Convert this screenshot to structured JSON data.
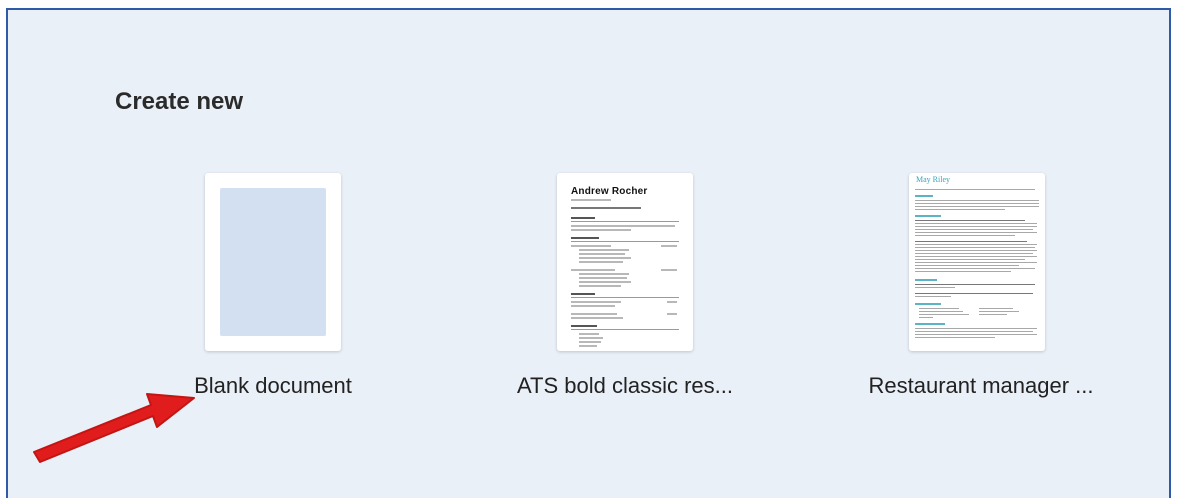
{
  "section": {
    "title": "Create new"
  },
  "templates": [
    {
      "label": "Blank document"
    },
    {
      "label": "ATS bold classic res...",
      "preview_name": "Andrew Rocher"
    },
    {
      "label": "Restaurant manager ...",
      "preview_name": "May Riley"
    }
  ],
  "colors": {
    "background": "#eaf0f8",
    "frame_border": "#2e5aa8",
    "blank_fill": "#d3e0f2",
    "annotation_arrow": "#e01c1c",
    "restaurant_accent": "#3aa2b8"
  }
}
